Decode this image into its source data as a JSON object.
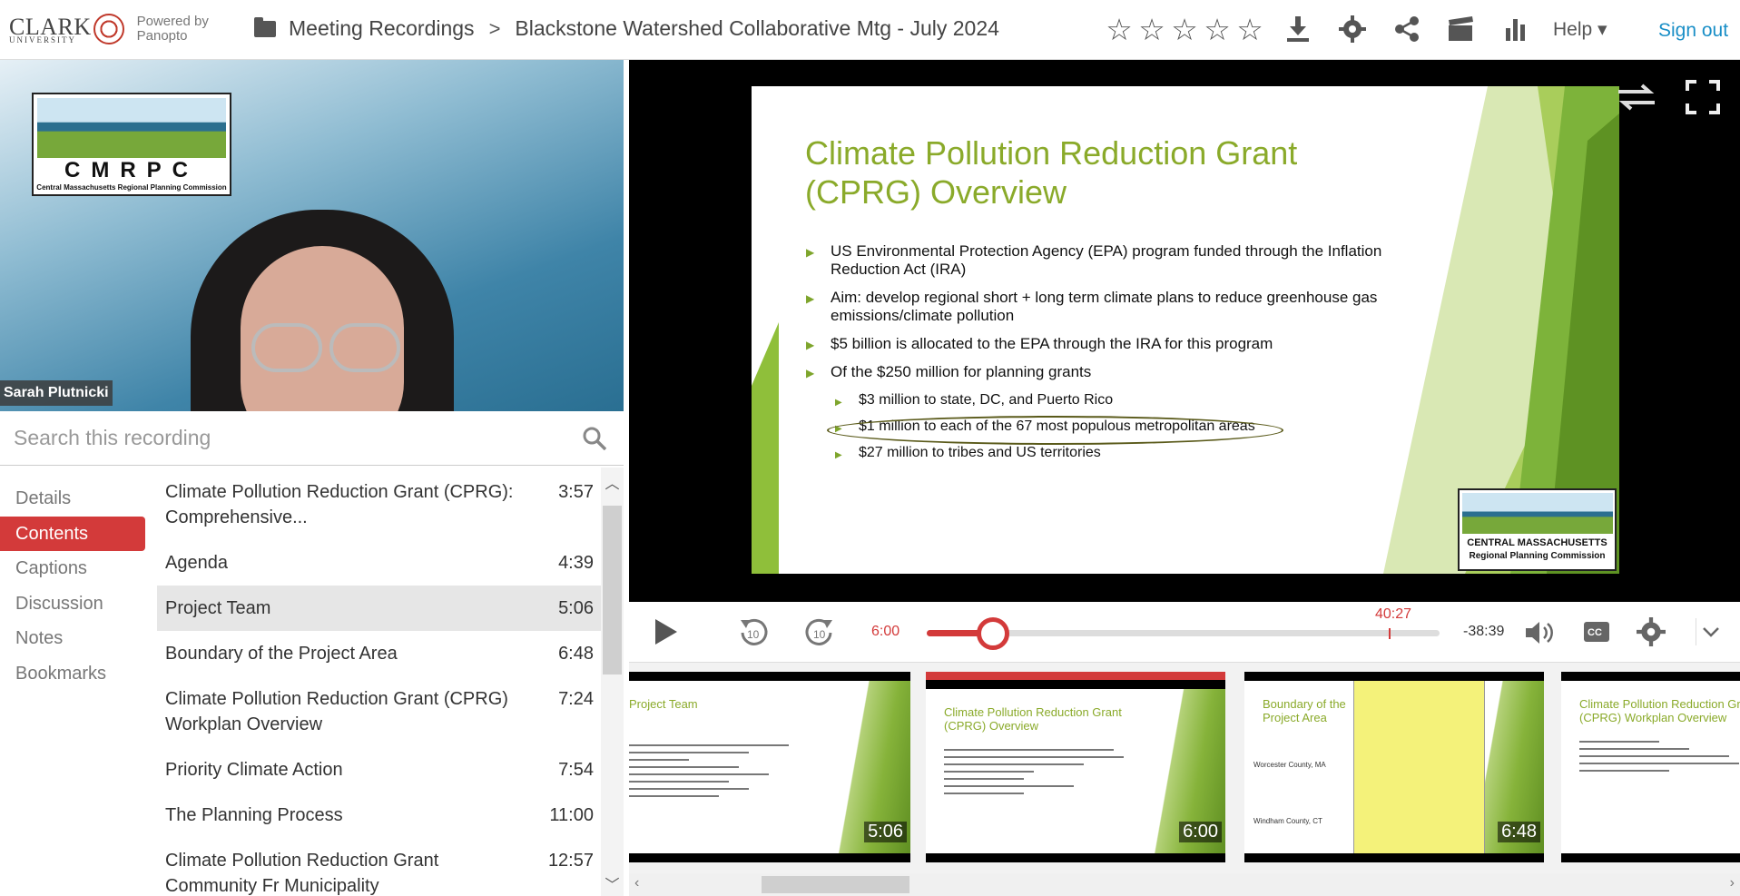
{
  "header": {
    "brand_name": "CLARK",
    "brand_sub": "UNIVERSITY",
    "powered_by_1": "Powered by",
    "powered_by_2": "Panopto",
    "breadcrumb_folder": "Meeting Recordings",
    "breadcrumb_sep": ">",
    "session_title": "Blackstone Watershed Collaborative Mtg - July 2024",
    "rating_stars": 5,
    "help_label": "Help ▾",
    "sign_out_label": "Sign out"
  },
  "webcam": {
    "logo_text": "CMRPC",
    "logo_subtitle": "Central Massachusetts Regional Planning Commission",
    "speaker_name": "Sarah Plutnicki"
  },
  "search": {
    "placeholder": "Search this recording"
  },
  "side_nav": {
    "items": [
      {
        "label": "Details"
      },
      {
        "label": "Contents",
        "active": true
      },
      {
        "label": "Captions"
      },
      {
        "label": "Discussion"
      },
      {
        "label": "Notes"
      },
      {
        "label": "Bookmarks"
      }
    ]
  },
  "contents": {
    "items": [
      {
        "title": "Climate Pollution Reduction Grant (CPRG): Comprehensive...",
        "time": "3:57"
      },
      {
        "title": "Agenda",
        "time": "4:39"
      },
      {
        "title": "Project Team",
        "time": "5:06",
        "selected": true
      },
      {
        "title": "Boundary of the Project Area",
        "time": "6:48"
      },
      {
        "title": "Climate Pollution Reduction Grant (CPRG) Workplan Overview",
        "time": "7:24"
      },
      {
        "title": "Priority Climate Action",
        "time": "7:54"
      },
      {
        "title": "The Planning Process",
        "time": "11:00"
      },
      {
        "title": "Climate Pollution Reduction Grant Community Fr Municipality",
        "time": "12:57"
      }
    ]
  },
  "slide": {
    "title": "Climate Pollution Reduction Grant (CPRG) Overview",
    "bullets": [
      {
        "text": "US Environmental Protection Agency (EPA) program funded through the Inflation Reduction Act (IRA)",
        "level": 1
      },
      {
        "text": "Aim: develop regional short + long term climate plans to reduce greenhouse gas emissions/climate pollution",
        "level": 1
      },
      {
        "text": "$5 billion is allocated to the EPA through the IRA for this program",
        "level": 1
      },
      {
        "text": "Of the $250 million for planning grants",
        "level": 1
      },
      {
        "text": "$3 million to state, DC, and Puerto Rico",
        "level": 2
      },
      {
        "text": "$1 million to each of the 67 most populous metropolitan areas",
        "level": 2
      },
      {
        "text": "$27 million to tribes and US territories",
        "level": 2
      }
    ],
    "logo_line1": "CENTRAL MASSACHUSETTS",
    "logo_line2": "Regional Planning Commission"
  },
  "player": {
    "current_time": "6:00",
    "remaining_time": "-38:39",
    "marker_time": "40:27",
    "progress_fraction": 0.13,
    "marker_fraction": 0.9
  },
  "thumbnails": [
    {
      "title": "Project Team",
      "time": "5:06"
    },
    {
      "title": "Climate Pollution Reduction Grant (CPRG) Overview",
      "time": "6:00",
      "current": true
    },
    {
      "title": "Boundary of the Project Area",
      "time": "6:48",
      "label_a": "Worcester County, MA",
      "label_b": "Windham County, CT"
    },
    {
      "title": "Climate Pollution Reduction Grant (CPRG) Workplan Overview",
      "time": ""
    }
  ],
  "colors": {
    "accent_red": "#d33a3a",
    "link_blue": "#1a8fc7",
    "slide_green": "#8aaa2a"
  }
}
